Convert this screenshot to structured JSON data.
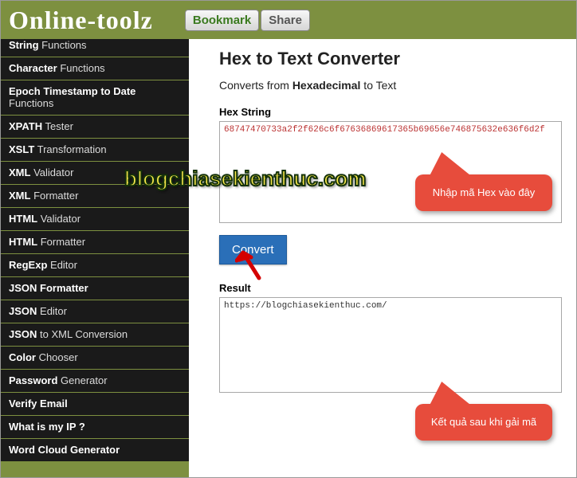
{
  "header": {
    "logo": "Online-toolz",
    "bookmark": "Bookmark",
    "share": "Share"
  },
  "sidebar": {
    "items": [
      {
        "bold": "String",
        "light": " Functions"
      },
      {
        "bold": "Character",
        "light": " Functions"
      },
      {
        "bold": "Epoch Timestamp to Date",
        "light": " Functions"
      },
      {
        "bold": "XPATH",
        "light": " Tester"
      },
      {
        "bold": "XSLT",
        "light": " Transformation"
      },
      {
        "bold": "XML",
        "light": " Validator"
      },
      {
        "bold": "XML",
        "light": " Formatter"
      },
      {
        "bold": "HTML",
        "light": " Validator"
      },
      {
        "bold": "HTML",
        "light": " Formatter"
      },
      {
        "bold": "RegExp",
        "light": " Editor"
      },
      {
        "bold": "JSON Formatter",
        "light": ""
      },
      {
        "bold": "JSON",
        "light": " Editor"
      },
      {
        "bold": "JSON",
        "light": " to XML Conversion"
      },
      {
        "bold": "Color",
        "light": " Chooser"
      },
      {
        "bold": "Password",
        "light": " Generator"
      },
      {
        "bold": "Verify Email",
        "light": ""
      },
      {
        "bold": "What is my IP ?",
        "light": ""
      },
      {
        "bold": "Word Cloud Generator",
        "light": ""
      }
    ]
  },
  "main": {
    "title": "Hex to Text Converter",
    "sub_pre": "Converts from ",
    "sub_bold": "Hexadecimal",
    "sub_post": " to Text",
    "hex_label": "Hex String",
    "hex_value": "68747470733a2f2f626c6f67636869617365b69656e746875632e636f6d2f",
    "convert": "Convert",
    "result_label": "Result",
    "result_value": "https://blogchiasekienthuc.com/"
  },
  "callouts": {
    "c1": "Nhập mã Hex vào đây",
    "c2": "Kết quả sau khi gải mã"
  },
  "watermark": "blogchiasekienthuc.com"
}
